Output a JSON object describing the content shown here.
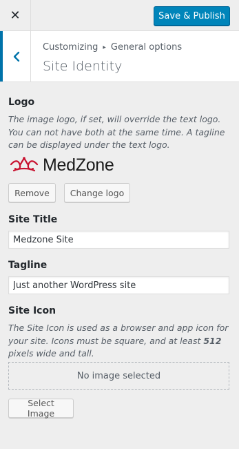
{
  "header": {
    "close_icon": "close-icon",
    "publish_label": "Save & Publish",
    "accent_color": "#0085ba"
  },
  "section": {
    "breadcrumb_root": "Customizing",
    "breadcrumb_separator": "▸",
    "breadcrumb_current": "General options",
    "title": "Site Identity",
    "back_icon": "chevron-left-icon"
  },
  "logo": {
    "label": "Logo",
    "description": "The image logo, if set, will override the text logo. You can not have both at the same time. A tagline can be displayed under the text logo.",
    "image_text": "MedZone",
    "brand_color": "#c8102e",
    "remove_label": "Remove",
    "change_label": "Change logo"
  },
  "site_title": {
    "label": "Site Title",
    "value": "Medzone Site"
  },
  "tagline": {
    "label": "Tagline",
    "value": "Just another WordPress site"
  },
  "site_icon": {
    "label": "Site Icon",
    "description_before": "The Site Icon is used as a browser and app icon for your site. Icons must be square, and at least ",
    "description_bold": "512",
    "description_after": " pixels wide and tall.",
    "empty_text": "No image selected",
    "select_label": "Select Image"
  }
}
